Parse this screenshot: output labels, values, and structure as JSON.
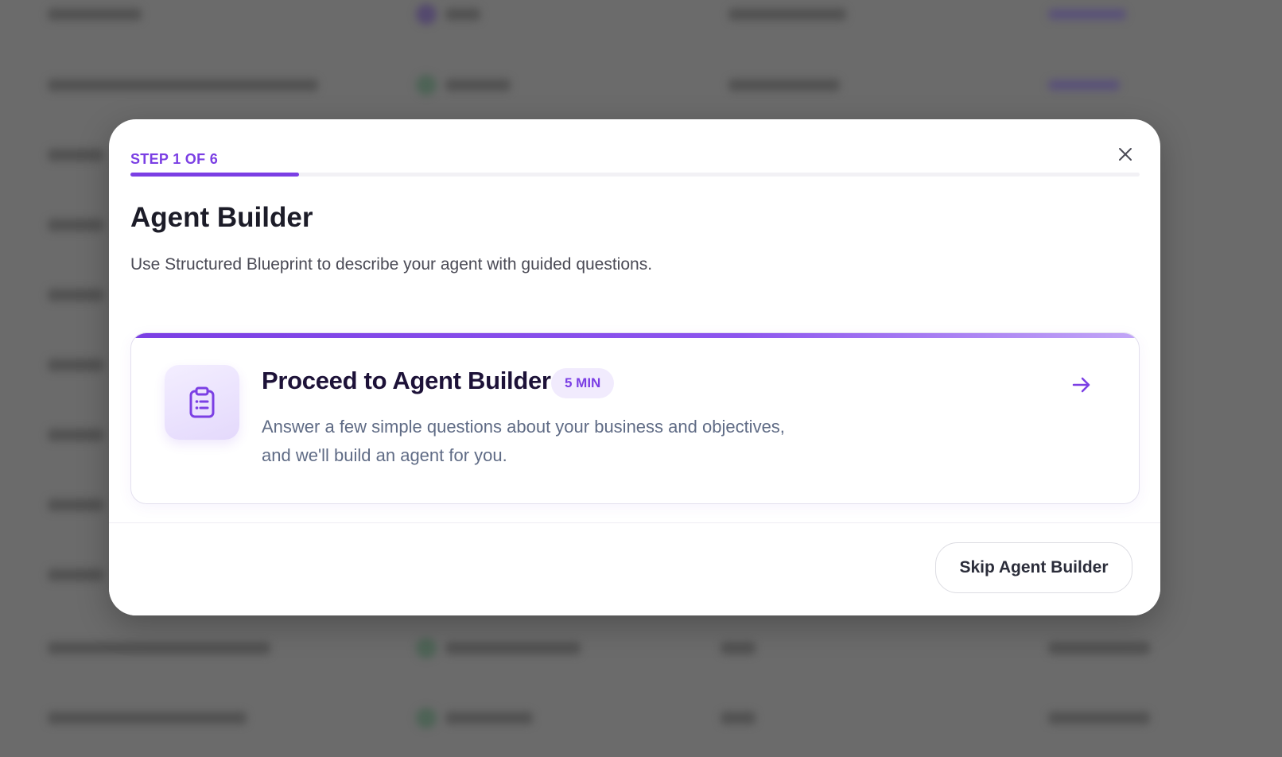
{
  "modal": {
    "step_label": "STEP 1 OF 6",
    "progress": 0.167,
    "title": "Agent Builder",
    "subtitle": "Use Structured Blueprint to describe your agent with guided questions.",
    "close_icon": "close-icon"
  },
  "option": {
    "icon": "clipboard-list-icon",
    "title": "Proceed to Agent Builder",
    "badge": "5 MIN",
    "description_line1": "Answer a few simple questions about your business and objectives,",
    "description_line2": "and we'll build an agent for you.",
    "arrow_icon": "arrow-right-icon"
  },
  "footer": {
    "skip_label": "Skip Agent Builder"
  },
  "colors": {
    "accent": "#7b3fe4",
    "overlay": "#6b6b6b"
  }
}
